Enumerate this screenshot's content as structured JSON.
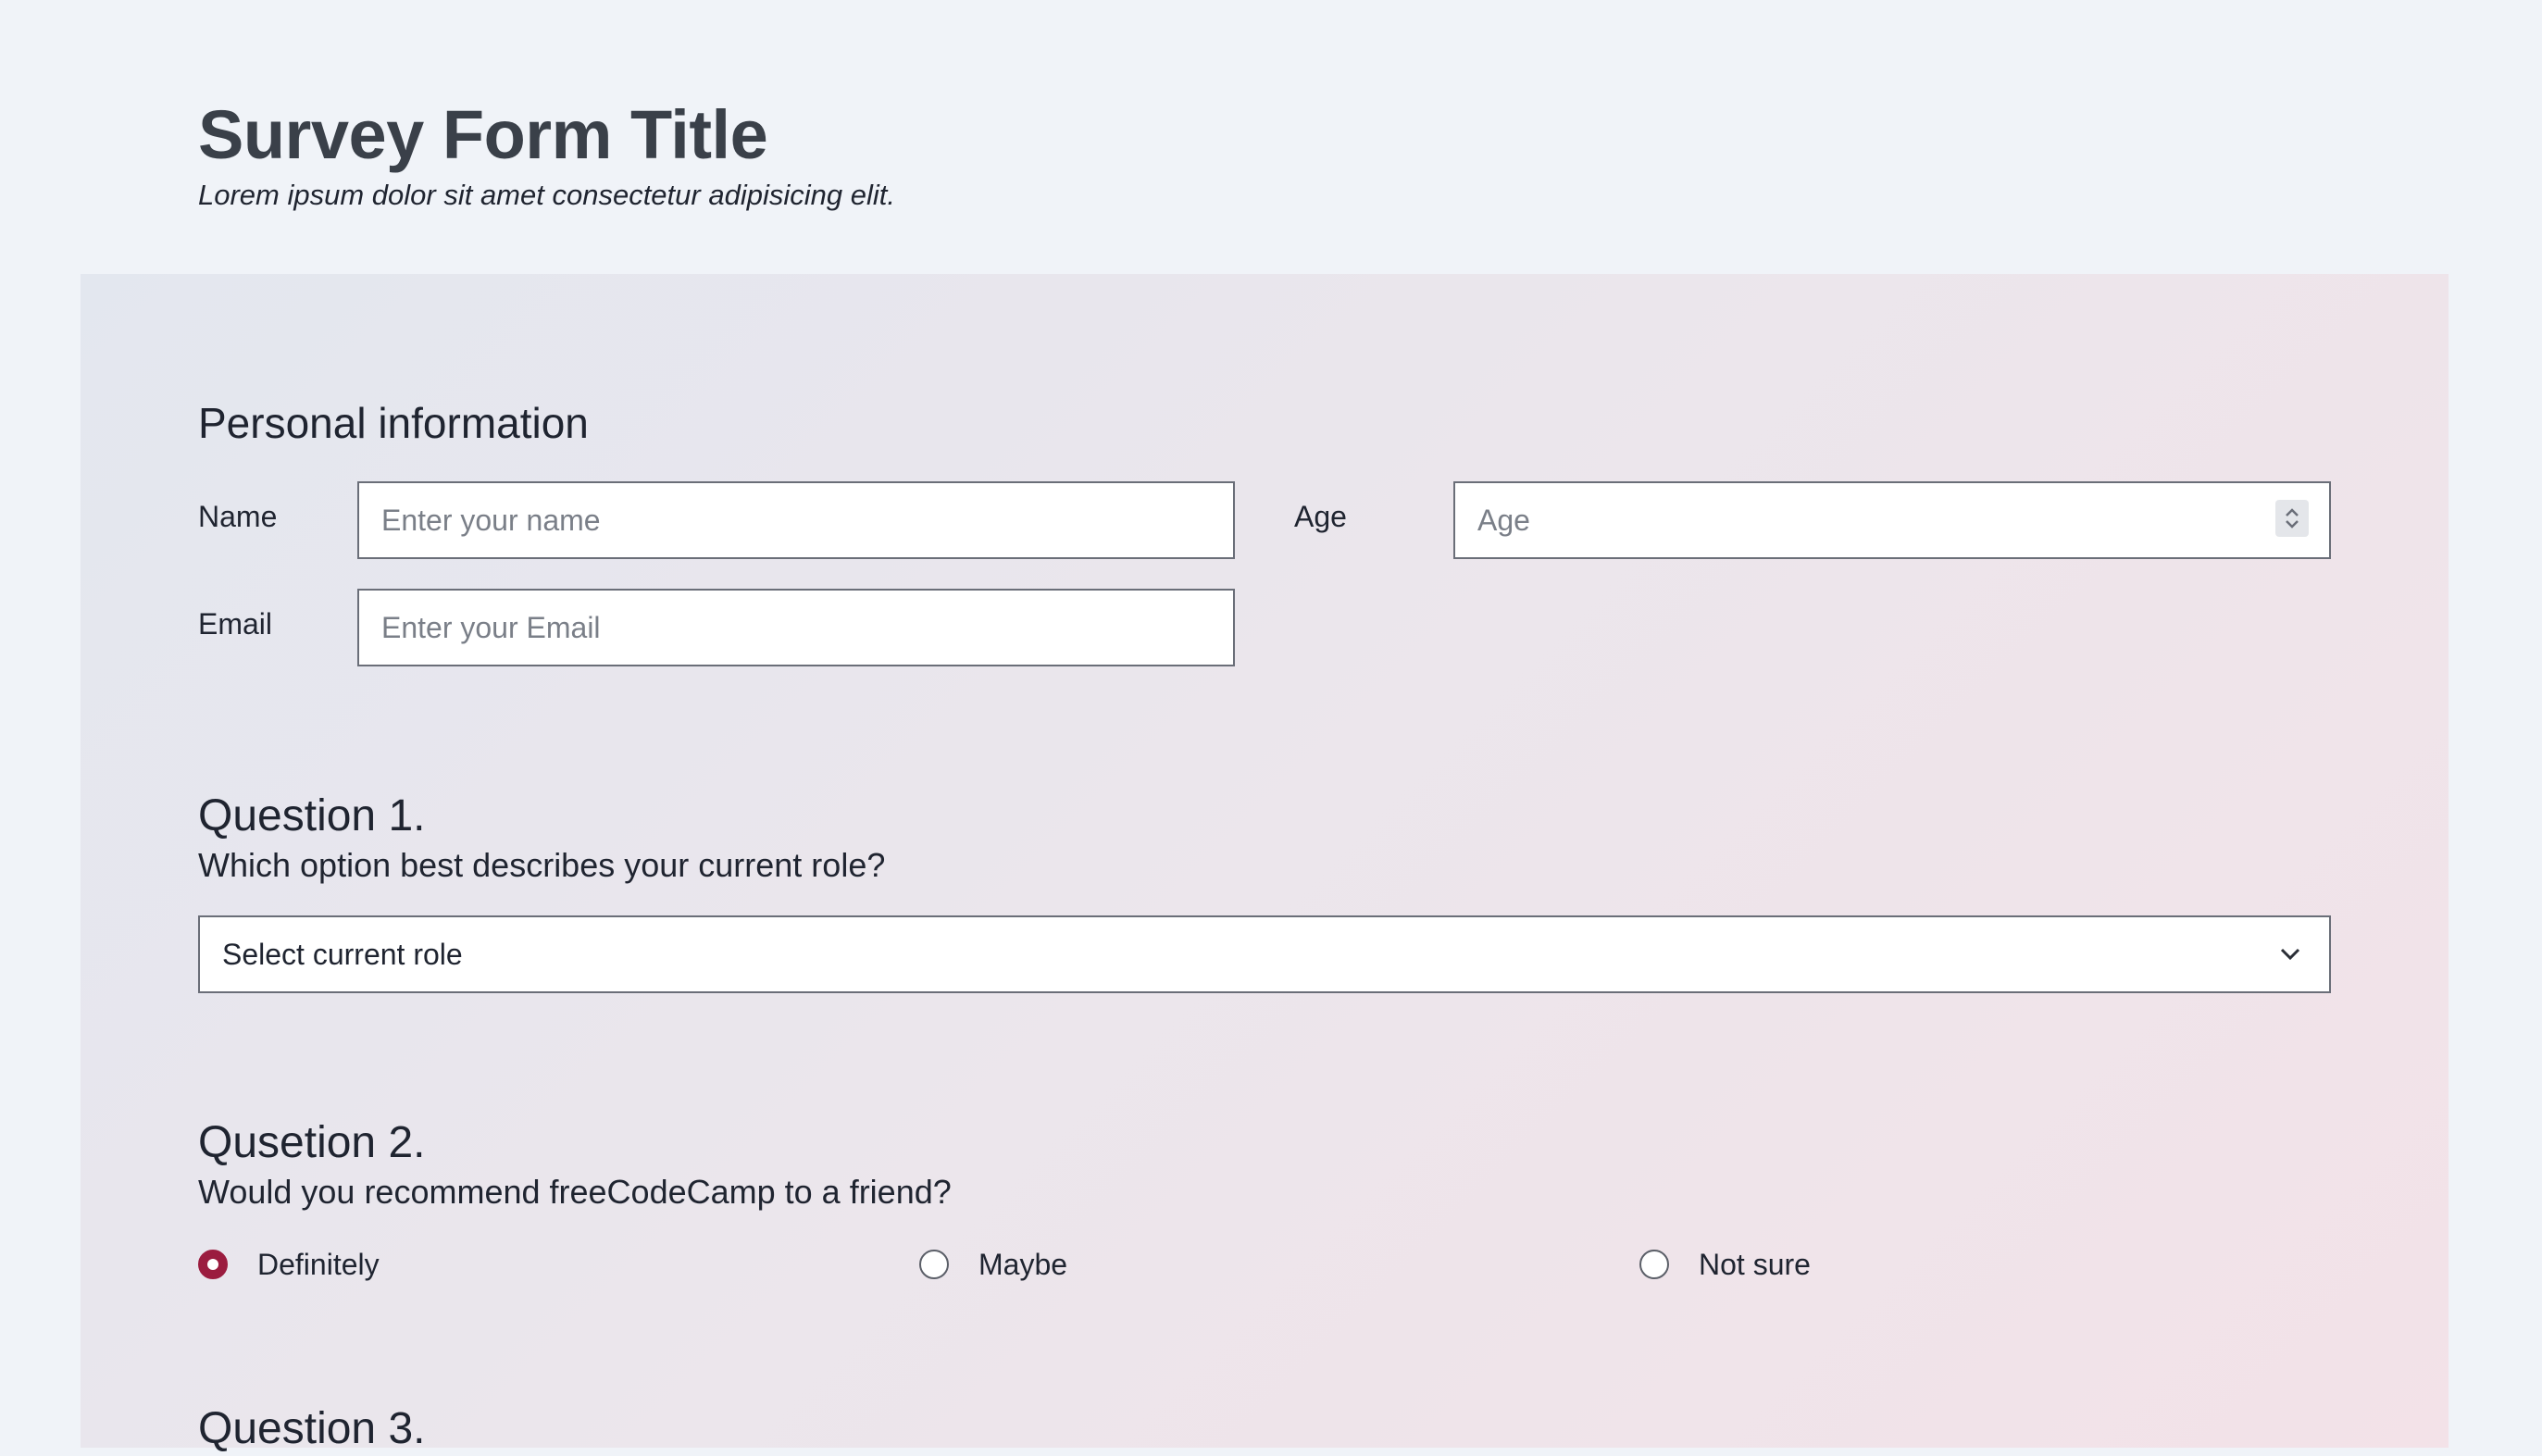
{
  "header": {
    "title": "Survey Form Title",
    "subtitle": "Lorem ipsum dolor sit amet consectetur adipisicing elit."
  },
  "personal": {
    "heading": "Personal information",
    "name_label": "Name",
    "name_placeholder": "Enter your name",
    "age_label": "Age",
    "age_placeholder": "Age",
    "email_label": "Email",
    "email_placeholder": "Enter your Email"
  },
  "question1": {
    "title": "Question 1.",
    "text": "Which option best describes your current role?",
    "select_value": "Select current role"
  },
  "question2": {
    "title": "Qusetion 2.",
    "text": "Would you recommend freeCodeCamp to a friend?",
    "options": [
      {
        "label": "Definitely",
        "checked": true
      },
      {
        "label": "Maybe",
        "checked": false
      },
      {
        "label": "Not sure",
        "checked": false
      }
    ]
  },
  "question3": {
    "title": "Question 3."
  },
  "colors": {
    "accent": "#9b1c3f",
    "title": "#3a4049",
    "border": "#6a6e78"
  },
  "icons": {
    "spinner": "spinner-arrows-icon",
    "chevron": "chevron-down-icon"
  }
}
